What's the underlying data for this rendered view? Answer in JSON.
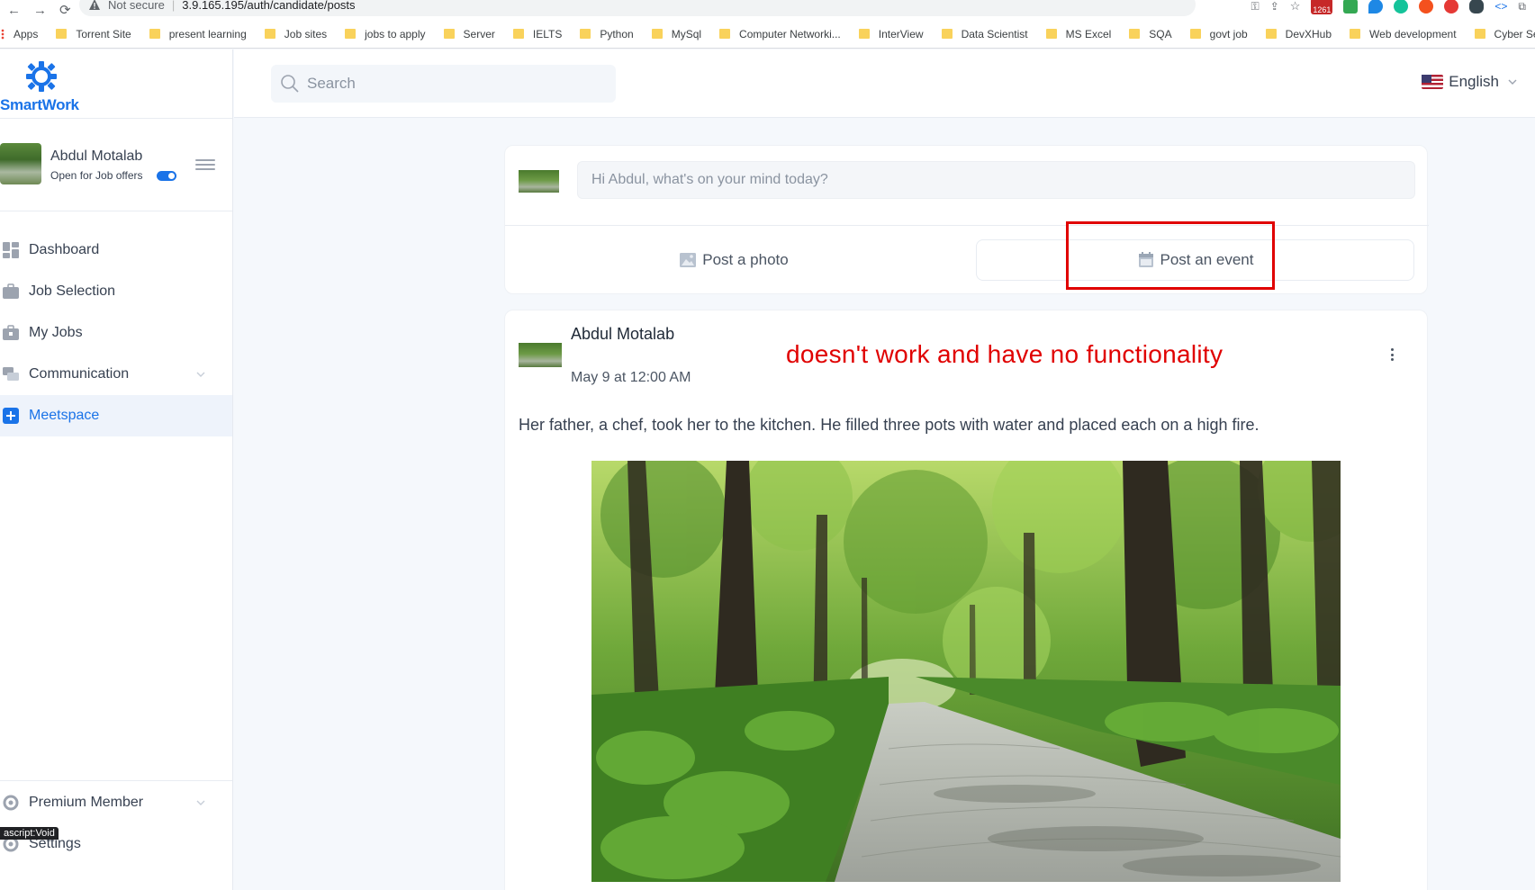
{
  "browser": {
    "security_label": "Not secure",
    "url": "3.9.165.195/auth/candidate/posts",
    "extension_badge": "1261",
    "bookmarks": [
      "Apps",
      "Torrent Site",
      "present learning",
      "Job sites",
      "jobs to apply",
      "Server",
      "IELTS",
      "Python",
      "MySql",
      "Computer Networki...",
      "InterView",
      "Data Scientist",
      "MS Excel",
      "SQA",
      "govt job",
      "DevXHub",
      "Web development",
      "Cyber Security"
    ]
  },
  "brand": {
    "name": "SmartWork",
    "color": "#1a73e8"
  },
  "profile": {
    "name": "Abdul Motalab",
    "status": "Open for Job offers"
  },
  "nav": {
    "items": [
      {
        "label": "Dashboard",
        "icon": "dashboard-icon"
      },
      {
        "label": "Job Selection",
        "icon": "briefcase-icon"
      },
      {
        "label": "My Jobs",
        "icon": "briefcase-lock-icon"
      },
      {
        "label": "Communication",
        "icon": "chat-icon"
      },
      {
        "label": "Meetspace",
        "icon": "plus-square-icon",
        "active": true
      }
    ],
    "bottom": [
      {
        "label": "Premium Member",
        "icon": "gear-icon"
      },
      {
        "label": "Settings",
        "icon": "gear-icon"
      }
    ],
    "status_tooltip": "ascript:Void"
  },
  "topbar": {
    "search_placeholder": "Search",
    "language": "English"
  },
  "composer": {
    "placeholder": "Hi Abdul, what's on your mind today?",
    "post_photo": "Post a photo",
    "post_event": "Post an event"
  },
  "post": {
    "author": "Abdul Motalab",
    "date": "May 9 at 12:00 AM",
    "body": "Her father, a chef, took her to the kitchen. He filled three pots with water and placed each on a high fire."
  },
  "annotation": {
    "text": "doesn't work and have no functionality",
    "color": "#e00000"
  }
}
